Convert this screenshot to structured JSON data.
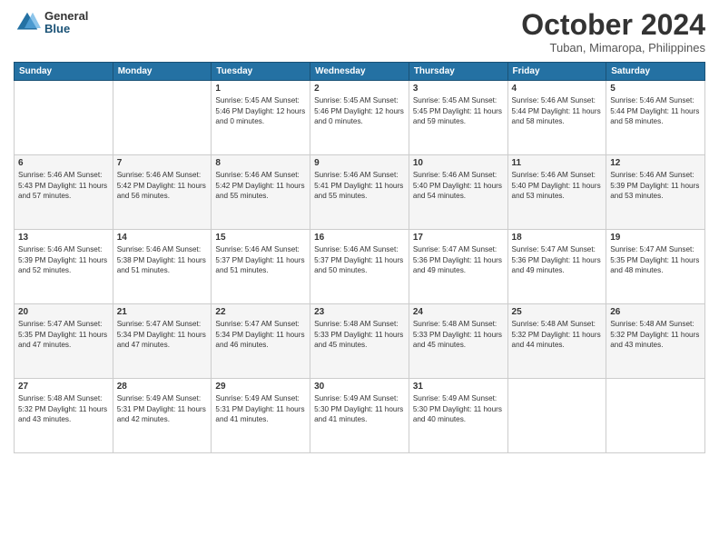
{
  "header": {
    "logo_general": "General",
    "logo_blue": "Blue",
    "month_title": "October 2024",
    "location": "Tuban, Mimaropa, Philippines"
  },
  "weekdays": [
    "Sunday",
    "Monday",
    "Tuesday",
    "Wednesday",
    "Thursday",
    "Friday",
    "Saturday"
  ],
  "weeks": [
    [
      {
        "day": "",
        "info": ""
      },
      {
        "day": "",
        "info": ""
      },
      {
        "day": "1",
        "info": "Sunrise: 5:45 AM\nSunset: 5:46 PM\nDaylight: 12 hours\nand 0 minutes."
      },
      {
        "day": "2",
        "info": "Sunrise: 5:45 AM\nSunset: 5:46 PM\nDaylight: 12 hours\nand 0 minutes."
      },
      {
        "day": "3",
        "info": "Sunrise: 5:45 AM\nSunset: 5:45 PM\nDaylight: 11 hours\nand 59 minutes."
      },
      {
        "day": "4",
        "info": "Sunrise: 5:46 AM\nSunset: 5:44 PM\nDaylight: 11 hours\nand 58 minutes."
      },
      {
        "day": "5",
        "info": "Sunrise: 5:46 AM\nSunset: 5:44 PM\nDaylight: 11 hours\nand 58 minutes."
      }
    ],
    [
      {
        "day": "6",
        "info": "Sunrise: 5:46 AM\nSunset: 5:43 PM\nDaylight: 11 hours\nand 57 minutes."
      },
      {
        "day": "7",
        "info": "Sunrise: 5:46 AM\nSunset: 5:42 PM\nDaylight: 11 hours\nand 56 minutes."
      },
      {
        "day": "8",
        "info": "Sunrise: 5:46 AM\nSunset: 5:42 PM\nDaylight: 11 hours\nand 55 minutes."
      },
      {
        "day": "9",
        "info": "Sunrise: 5:46 AM\nSunset: 5:41 PM\nDaylight: 11 hours\nand 55 minutes."
      },
      {
        "day": "10",
        "info": "Sunrise: 5:46 AM\nSunset: 5:40 PM\nDaylight: 11 hours\nand 54 minutes."
      },
      {
        "day": "11",
        "info": "Sunrise: 5:46 AM\nSunset: 5:40 PM\nDaylight: 11 hours\nand 53 minutes."
      },
      {
        "day": "12",
        "info": "Sunrise: 5:46 AM\nSunset: 5:39 PM\nDaylight: 11 hours\nand 53 minutes."
      }
    ],
    [
      {
        "day": "13",
        "info": "Sunrise: 5:46 AM\nSunset: 5:39 PM\nDaylight: 11 hours\nand 52 minutes."
      },
      {
        "day": "14",
        "info": "Sunrise: 5:46 AM\nSunset: 5:38 PM\nDaylight: 11 hours\nand 51 minutes."
      },
      {
        "day": "15",
        "info": "Sunrise: 5:46 AM\nSunset: 5:37 PM\nDaylight: 11 hours\nand 51 minutes."
      },
      {
        "day": "16",
        "info": "Sunrise: 5:46 AM\nSunset: 5:37 PM\nDaylight: 11 hours\nand 50 minutes."
      },
      {
        "day": "17",
        "info": "Sunrise: 5:47 AM\nSunset: 5:36 PM\nDaylight: 11 hours\nand 49 minutes."
      },
      {
        "day": "18",
        "info": "Sunrise: 5:47 AM\nSunset: 5:36 PM\nDaylight: 11 hours\nand 49 minutes."
      },
      {
        "day": "19",
        "info": "Sunrise: 5:47 AM\nSunset: 5:35 PM\nDaylight: 11 hours\nand 48 minutes."
      }
    ],
    [
      {
        "day": "20",
        "info": "Sunrise: 5:47 AM\nSunset: 5:35 PM\nDaylight: 11 hours\nand 47 minutes."
      },
      {
        "day": "21",
        "info": "Sunrise: 5:47 AM\nSunset: 5:34 PM\nDaylight: 11 hours\nand 47 minutes."
      },
      {
        "day": "22",
        "info": "Sunrise: 5:47 AM\nSunset: 5:34 PM\nDaylight: 11 hours\nand 46 minutes."
      },
      {
        "day": "23",
        "info": "Sunrise: 5:48 AM\nSunset: 5:33 PM\nDaylight: 11 hours\nand 45 minutes."
      },
      {
        "day": "24",
        "info": "Sunrise: 5:48 AM\nSunset: 5:33 PM\nDaylight: 11 hours\nand 45 minutes."
      },
      {
        "day": "25",
        "info": "Sunrise: 5:48 AM\nSunset: 5:32 PM\nDaylight: 11 hours\nand 44 minutes."
      },
      {
        "day": "26",
        "info": "Sunrise: 5:48 AM\nSunset: 5:32 PM\nDaylight: 11 hours\nand 43 minutes."
      }
    ],
    [
      {
        "day": "27",
        "info": "Sunrise: 5:48 AM\nSunset: 5:32 PM\nDaylight: 11 hours\nand 43 minutes."
      },
      {
        "day": "28",
        "info": "Sunrise: 5:49 AM\nSunset: 5:31 PM\nDaylight: 11 hours\nand 42 minutes."
      },
      {
        "day": "29",
        "info": "Sunrise: 5:49 AM\nSunset: 5:31 PM\nDaylight: 11 hours\nand 41 minutes."
      },
      {
        "day": "30",
        "info": "Sunrise: 5:49 AM\nSunset: 5:30 PM\nDaylight: 11 hours\nand 41 minutes."
      },
      {
        "day": "31",
        "info": "Sunrise: 5:49 AM\nSunset: 5:30 PM\nDaylight: 11 hours\nand 40 minutes."
      },
      {
        "day": "",
        "info": ""
      },
      {
        "day": "",
        "info": ""
      }
    ]
  ]
}
